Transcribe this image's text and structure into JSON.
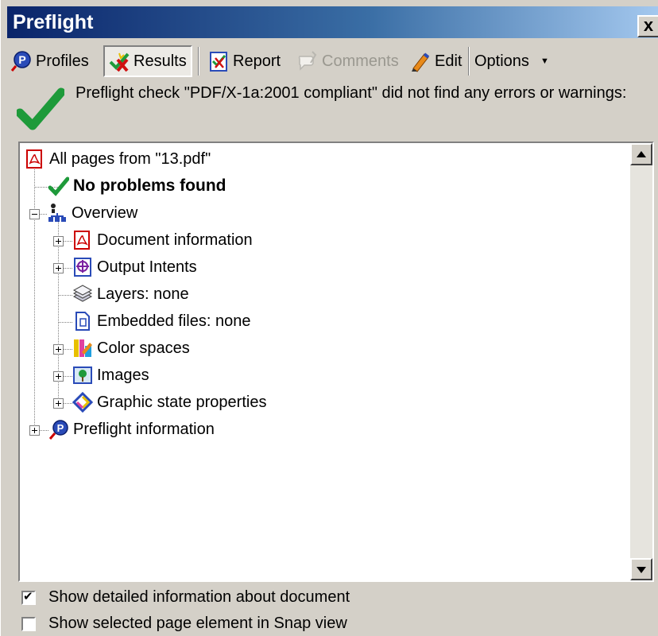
{
  "window": {
    "title": "Preflight",
    "close_label": "x"
  },
  "toolbar": {
    "profiles": "Profiles",
    "results": "Results",
    "report": "Report",
    "comments": "Comments",
    "edit": "Edit",
    "options": "Options"
  },
  "status": {
    "message": "Preflight check \"PDF/X-1a:2001 compliant\" did not find any errors or warnings:"
  },
  "tree": {
    "root": "All pages from \"13.pdf\"",
    "no_problems": "No problems found",
    "overview": "Overview",
    "document_information": "Document information",
    "output_intents": "Output Intents",
    "layers": "Layers: none",
    "embedded_files": "Embedded files: none",
    "color_spaces": "Color spaces",
    "images": "Images",
    "graphic_state": "Graphic state properties",
    "preflight_information": "Preflight information"
  },
  "options": {
    "show_detailed": {
      "label": "Show detailed information about document",
      "checked": true
    },
    "show_snap": {
      "label": "Show selected page element in Snap view",
      "checked": false
    }
  },
  "colors": {
    "title_start": "#0a246a",
    "title_end": "#a6caf0",
    "check_green": "#1e9a3a",
    "window_bg": "#d4d0c8"
  }
}
